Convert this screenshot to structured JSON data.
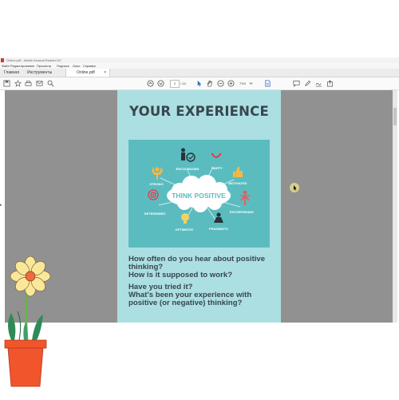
{
  "window": {
    "title": "Online.pdf - Adobe Acrobat Reader DC"
  },
  "menu": [
    "Файл",
    "Редактирование",
    "Просмотр",
    "Подпись",
    "Окно",
    "Справка"
  ],
  "tabs": {
    "home": "Главная",
    "tools": "Инструменты",
    "document": "Online.pdf",
    "close": "×"
  },
  "toolbar": {
    "page_current": "2",
    "page_total": "/ 14",
    "zoom": "71%",
    "icons": [
      "save-icon",
      "bookmark-icon",
      "print-icon",
      "email-icon",
      "search-icon",
      "page-up-icon",
      "page-down-icon",
      "select-cursor-icon",
      "hand-tool-icon",
      "zoom-out-icon",
      "zoom-in-icon",
      "file-icon",
      "comment-icon",
      "pen-icon",
      "sign-icon",
      "share-icon"
    ]
  },
  "document": {
    "heading": "YOUR EXPERIENCE",
    "infographic": {
      "center": "THINK POSITIVE",
      "labels": [
        "ENCOURAGED",
        "HAPPY",
        "MOTIVATED",
        "ENTERPRISING",
        "PRAGMATIC",
        "OPTIMISTIC",
        "DETERMINED",
        "STRONG"
      ]
    },
    "questions": [
      "How often do you hear about positive",
      "thinking?",
      "How is it supposed to work?",
      "Have you tried it?",
      "What's been your experience with",
      "positive (or negative) thinking?"
    ]
  },
  "colors": {
    "viewer_bg": "#919191",
    "page_bg": "#acdfe2",
    "infographic_bg": "#5bbcc0",
    "heading": "#38464f",
    "flower_petal": "#fbe79a",
    "flower_center": "#ee6b3c",
    "pot": "#f0552c"
  }
}
